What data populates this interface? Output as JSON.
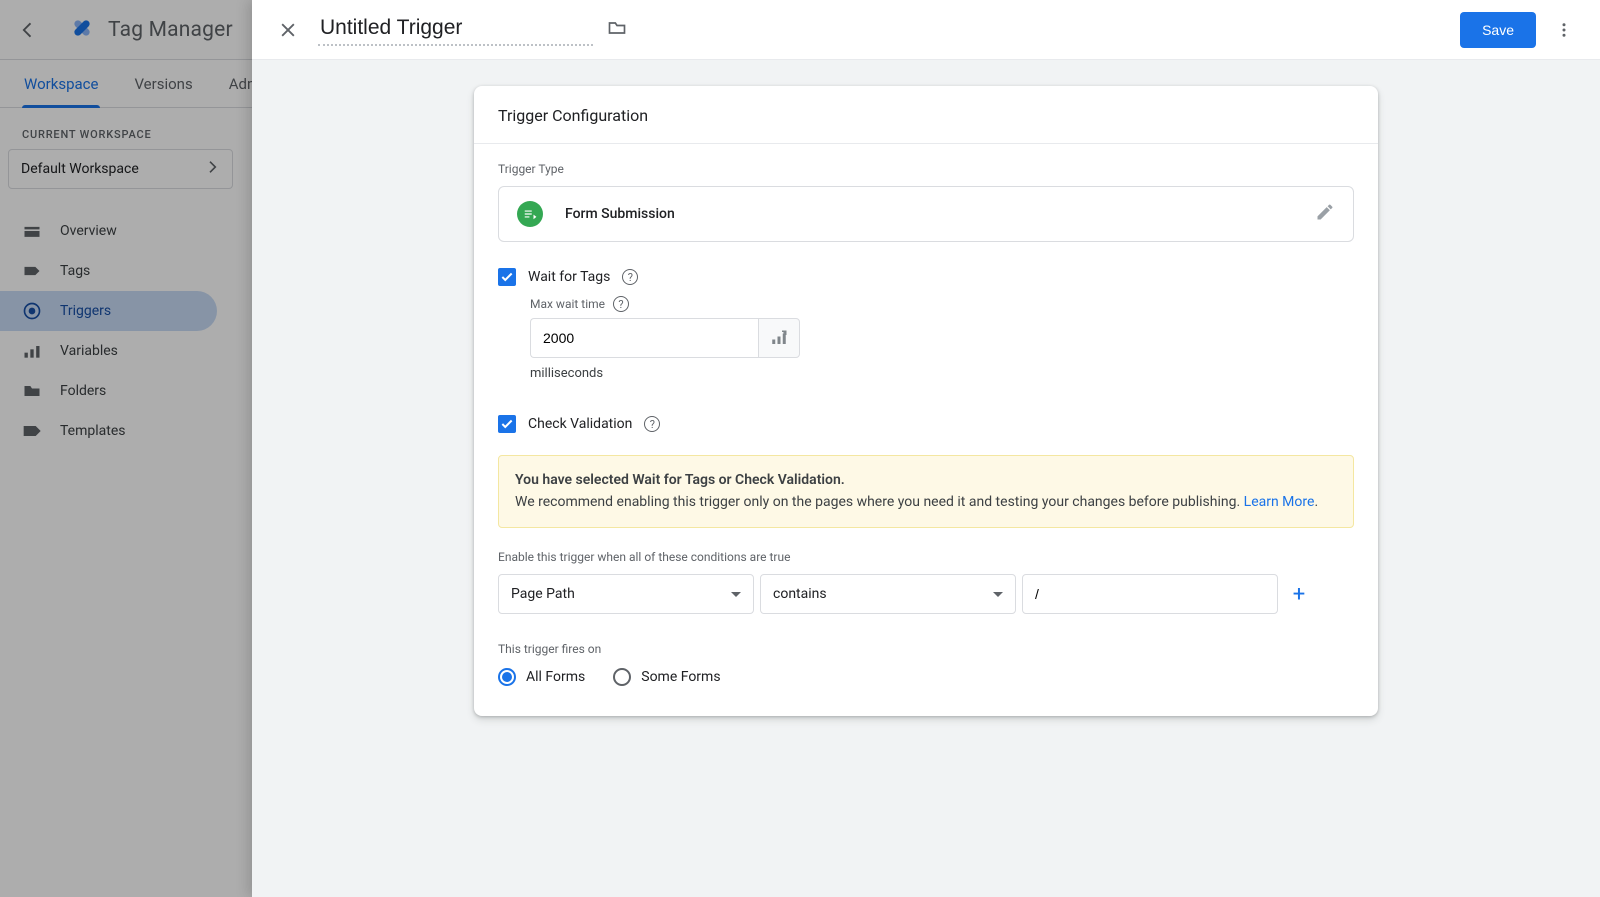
{
  "app": {
    "title": "Tag Manager"
  },
  "tabs": {
    "workspace": "Workspace",
    "versions": "Versions",
    "admin": "Adm"
  },
  "sidebar": {
    "cw_label": "CURRENT WORKSPACE",
    "workspace": "Default Workspace",
    "items": [
      {
        "label": "Overview"
      },
      {
        "label": "Tags"
      },
      {
        "label": "Triggers"
      },
      {
        "label": "Variables"
      },
      {
        "label": "Folders"
      },
      {
        "label": "Templates"
      }
    ]
  },
  "panel": {
    "title": "Untitled Trigger",
    "save": "Save",
    "card_heading": "Trigger Configuration",
    "tt_label": "Trigger Type",
    "tt_name": "Form Submission",
    "wait_label": "Wait for Tags",
    "max_wait_label": "Max wait time",
    "max_wait_value": "2000",
    "max_wait_unit": "milliseconds",
    "check_label": "Check Validation",
    "info_bold": "You have selected Wait for Tags or Check Validation.",
    "info_text": "We recommend enabling this trigger only on the pages where you need it and testing your changes before publishing. ",
    "learn_more": "Learn More",
    "dot": ".",
    "cond_label": "Enable this trigger when all of these conditions are true",
    "cond_var": "Page Path",
    "cond_op": "contains",
    "cond_val": "/",
    "fires_label": "This trigger fires on",
    "radio_all": "All Forms",
    "radio_some": "Some Forms"
  }
}
